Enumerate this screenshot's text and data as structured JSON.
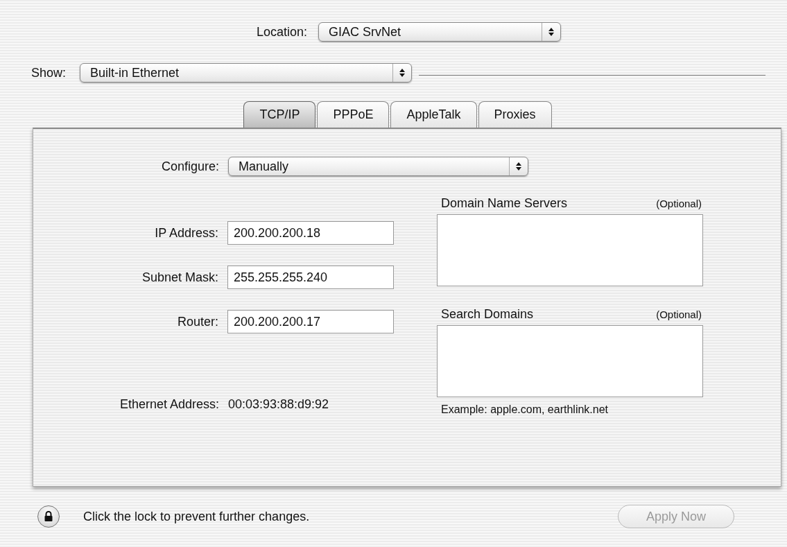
{
  "location": {
    "label": "Location:",
    "value": "GIAC SrvNet"
  },
  "show": {
    "label": "Show:",
    "value": "Built-in Ethernet"
  },
  "tabs": [
    {
      "label": "TCP/IP",
      "selected": true
    },
    {
      "label": "PPPoE",
      "selected": false
    },
    {
      "label": "AppleTalk",
      "selected": false
    },
    {
      "label": "Proxies",
      "selected": false
    }
  ],
  "configure": {
    "label": "Configure:",
    "value": "Manually"
  },
  "fields": [
    {
      "label": "IP Address:",
      "value": "200.200.200.18"
    },
    {
      "label": "Subnet Mask:",
      "value": "255.255.255.240"
    },
    {
      "label": "Router:",
      "value": "200.200.200.17"
    }
  ],
  "ethernet_address": {
    "label": "Ethernet Address:",
    "value": "00:03:93:88:d9:92"
  },
  "dns": {
    "title": "Domain Name Servers",
    "note": "(Optional)"
  },
  "search_domains": {
    "title": "Search Domains",
    "note": "(Optional)",
    "example": "Example: apple.com, earthlink.net"
  },
  "lock_message": "Click the lock to prevent further changes.",
  "apply_button": {
    "label": "Apply Now",
    "disabled": true
  }
}
